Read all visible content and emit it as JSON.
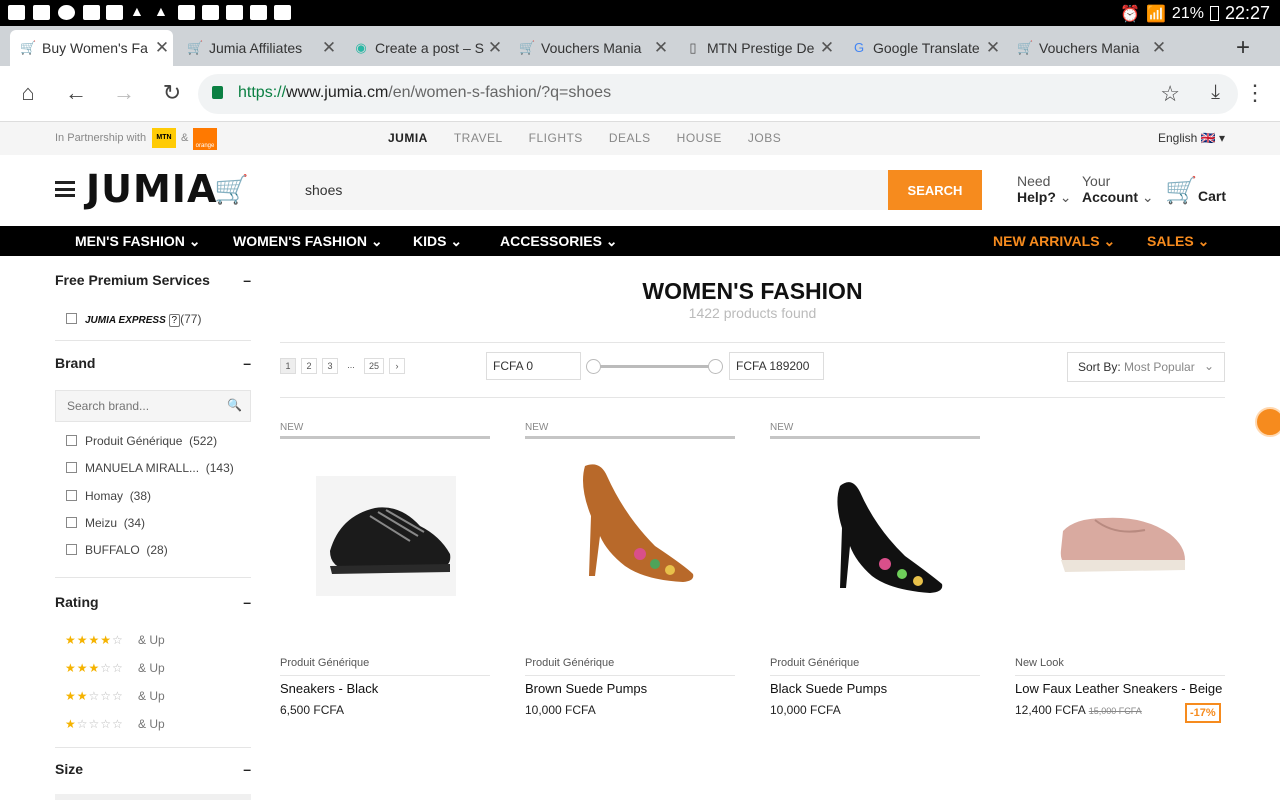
{
  "status": {
    "battery": "21%",
    "time": "22:27"
  },
  "tabs": [
    {
      "title": "Buy Women's Fa"
    },
    {
      "title": "Jumia Affiliates"
    },
    {
      "title": "Create a post – S"
    },
    {
      "title": "Vouchers Mania"
    },
    {
      "title": "MTN Prestige De"
    },
    {
      "title": "Google Translate"
    },
    {
      "title": "Vouchers Mania"
    }
  ],
  "address": {
    "scheme": "https://",
    "host": "www.jumia.cm",
    "path": "/en/women-s-fashion/?q=shoes"
  },
  "partner": {
    "label": "In Partnership with",
    "mtn": "MTN",
    "amp": "&",
    "orange": "orange",
    "services": [
      "JUMIA",
      "TRAVEL",
      "FLIGHTS",
      "DEALS",
      "HOUSE",
      "JOBS"
    ],
    "language": "English 🇬🇧 ▾"
  },
  "header": {
    "logo": "JUMIA",
    "search_value": "shoes",
    "search_label": "SEARCH",
    "help_top": "Need",
    "help_bottom": "Help?",
    "account_top": "Your",
    "account_bottom": "Account",
    "cart": "Cart"
  },
  "categories": [
    "MEN'S FASHION",
    "WOMEN'S FASHION",
    "KIDS",
    "ACCESSORIES",
    "NEW ARRIVALS",
    "SALES"
  ],
  "sidebar": {
    "premium_title": "Free Premium Services",
    "express_label": "JUMIA EXPRESS",
    "express_count": "(77)",
    "brand_title": "Brand",
    "brand_search_placeholder": "Search brand...",
    "brands": [
      {
        "name": "Produit Générique",
        "count": "(522)"
      },
      {
        "name": "MANUELA MIRALL...",
        "count": "(143)"
      },
      {
        "name": "Homay",
        "count": "(38)"
      },
      {
        "name": "Meizu",
        "count": "(34)"
      },
      {
        "name": "BUFFALO",
        "count": "(28)"
      }
    ],
    "rating_title": "Rating",
    "rating_andup": "& Up",
    "size_title": "Size"
  },
  "listing": {
    "title": "WOMEN'S FASHION",
    "count": "1422 products found",
    "pages": [
      "1",
      "2",
      "3",
      "...",
      "25",
      "›"
    ],
    "price_min": "FCFA 0",
    "price_max": "FCFA 189200",
    "sort_label": "Sort By:",
    "sort_value": "Most Popular",
    "products": [
      {
        "badge": "NEW",
        "brand": "Produit Générique",
        "name": "Sneakers - Black",
        "price": "6,500  FCFA"
      },
      {
        "badge": "NEW",
        "brand": "Produit Générique",
        "name": "Brown Suede Pumps",
        "price": "10,000  FCFA"
      },
      {
        "badge": "NEW",
        "brand": "Produit Générique",
        "name": "Black Suede Pumps",
        "price": "10,000  FCFA"
      },
      {
        "badge": "",
        "brand": "New Look",
        "name": "Low Faux Leather Sneakers - Beige",
        "price": "12,400  FCFA",
        "old_price": "15,000  FCFA",
        "discount": "-17%"
      }
    ]
  }
}
